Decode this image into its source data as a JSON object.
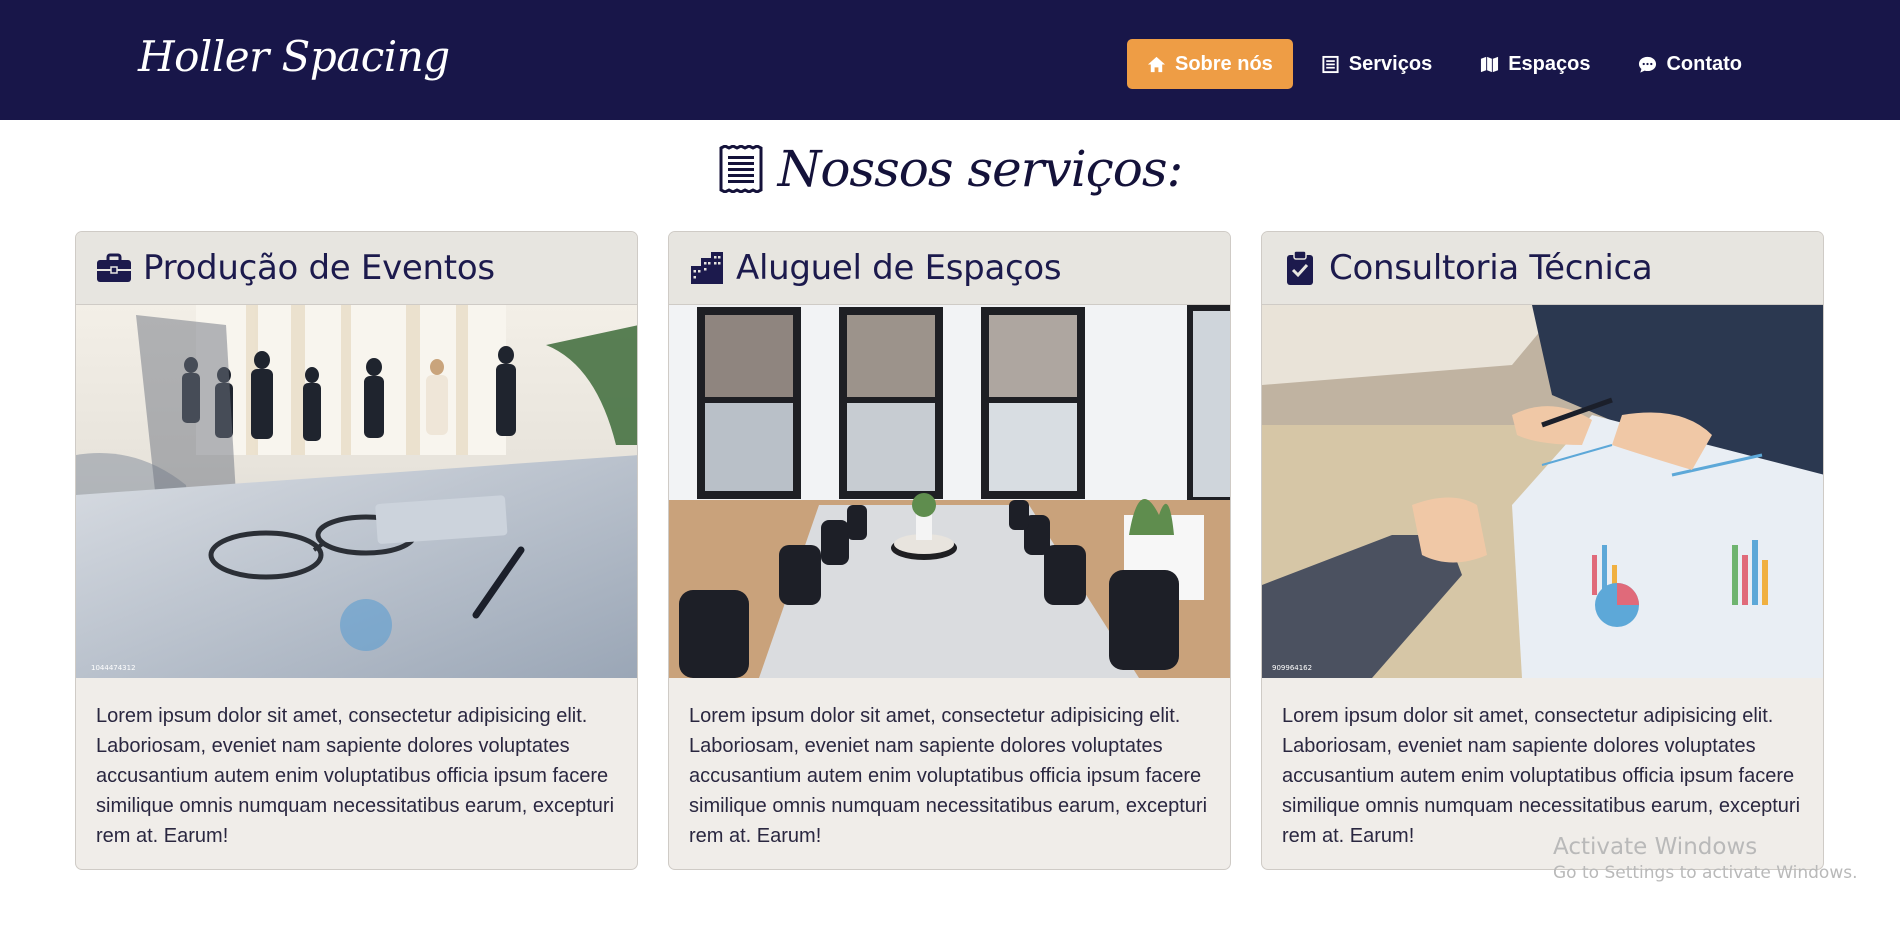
{
  "brand": "Holler Spacing",
  "nav": {
    "items": [
      {
        "label": "Sobre nós",
        "icon": "home-icon",
        "active": true
      },
      {
        "label": "Serviços",
        "icon": "receipt-icon"
      },
      {
        "label": "Espaços",
        "icon": "map-icon"
      },
      {
        "label": "Contato",
        "icon": "chat-icon"
      }
    ]
  },
  "services": {
    "title": "Nossos serviços:",
    "title_icon": "receipt-icon",
    "cards": [
      {
        "title": "Produção de Eventos",
        "icon": "briefcase-icon",
        "image": "office-team-meeting-photo",
        "text": "Lorem ipsum dolor sit amet, consectetur adipisicing elit. Laboriosam, eveniet nam sapiente dolores voluptates accusantium autem enim voluptatibus officia ipsum facere similique omnis numquam necessitatibus earum, excepturi rem at. Earum!"
      },
      {
        "title": "Aluguel de Espaços",
        "icon": "city-icon",
        "image": "meeting-room-photo",
        "text": "Lorem ipsum dolor sit amet, consectetur adipisicing elit. Laboriosam, eveniet nam sapiente dolores voluptates accusantium autem enim voluptatibus officia ipsum facere similique omnis numquam necessitatibus earum, excepturi rem at. Earum!"
      },
      {
        "title": "Consultoria Técnica",
        "icon": "clipboard-check-icon",
        "image": "business-consulting-photo",
        "text": "Lorem ipsum dolor sit amet, consectetur adipisicing elit. Laboriosam, eveniet nam sapiente dolores voluptates accusantium autem enim voluptatibus officia ipsum facere similique omnis numquam necessitatibus earum, excepturi rem at. Earum!"
      }
    ]
  },
  "watermark": {
    "line1": "Activate Windows",
    "line2": "Go to Settings to activate Windows."
  },
  "colors": {
    "navbar": "#181649",
    "accent": "#ee9d45",
    "card_bg": "#f0ede9",
    "title_text": "#1c1a4d"
  }
}
